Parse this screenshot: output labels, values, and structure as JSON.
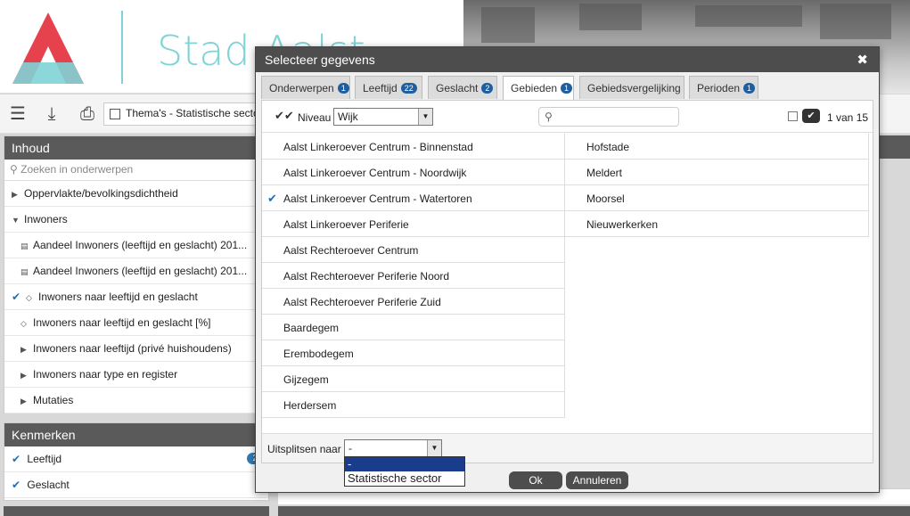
{
  "brand": {
    "title": "Stad Aalst"
  },
  "toolbar": {
    "theme_label": "Thema's - Statistische sector"
  },
  "inhoud": {
    "title": "Inhoud",
    "search_placeholder": "Zoeken in onderwerpen",
    "items": [
      {
        "label": "Oppervlakte/bevolkingsdichtheid"
      },
      {
        "label": "Inwoners"
      },
      {
        "label": "Aandeel Inwoners (leeftijd en geslacht) 201..."
      },
      {
        "label": "Aandeel Inwoners (leeftijd en geslacht) 201..."
      },
      {
        "label": "Inwoners naar leeftijd en geslacht"
      },
      {
        "label": "Inwoners naar leeftijd en geslacht [%]"
      },
      {
        "label": "Inwoners naar leeftijd (privé huishoudens)"
      },
      {
        "label": "Inwoners naar type en register"
      },
      {
        "label": "Mutaties"
      }
    ]
  },
  "kenmerken": {
    "title": "Kenmerken",
    "items": [
      {
        "label": "Leeftijd",
        "badge": "2"
      },
      {
        "label": "Geslacht",
        "badge": ""
      }
    ]
  },
  "modal": {
    "title": "Selecteer gegevens",
    "close": "✖",
    "tabs": [
      {
        "label": "Onderwerpen",
        "count": "1"
      },
      {
        "label": "Leeftijd",
        "count": "22"
      },
      {
        "label": "Geslacht",
        "count": "2"
      },
      {
        "label": "Gebieden",
        "count": "1"
      },
      {
        "label": "Gebiedsvergelijking",
        "count": ""
      },
      {
        "label": "Perioden",
        "count": "1"
      }
    ],
    "niveau_label": "Niveau",
    "niveau_value": "Wijk",
    "count_text": "1 van 15",
    "left_items": [
      {
        "label": "Aalst Linkeroever Centrum - Binnenstad",
        "checked": false
      },
      {
        "label": "Aalst Linkeroever Centrum - Noordwijk",
        "checked": false
      },
      {
        "label": "Aalst Linkeroever Centrum - Watertoren",
        "checked": true
      },
      {
        "label": "Aalst Linkeroever Periferie",
        "checked": false
      },
      {
        "label": "Aalst Rechteroever Centrum",
        "checked": false
      },
      {
        "label": "Aalst Rechteroever Periferie Noord",
        "checked": false
      },
      {
        "label": "Aalst Rechteroever Periferie Zuid",
        "checked": false
      },
      {
        "label": "Baardegem",
        "checked": false
      },
      {
        "label": "Erembodegem",
        "checked": false
      },
      {
        "label": "Gijzegem",
        "checked": false
      },
      {
        "label": "Herdersem",
        "checked": false
      }
    ],
    "right_items": [
      {
        "label": "Hofstade"
      },
      {
        "label": "Meldert"
      },
      {
        "label": "Moorsel"
      },
      {
        "label": "Nieuwerkerken"
      }
    ],
    "split_label": "Uitsplitsen naar",
    "split_value": "-",
    "split_options": [
      "-",
      "Statistische sector"
    ],
    "ok_label": "Ok",
    "cancel_label": "Annuleren"
  }
}
